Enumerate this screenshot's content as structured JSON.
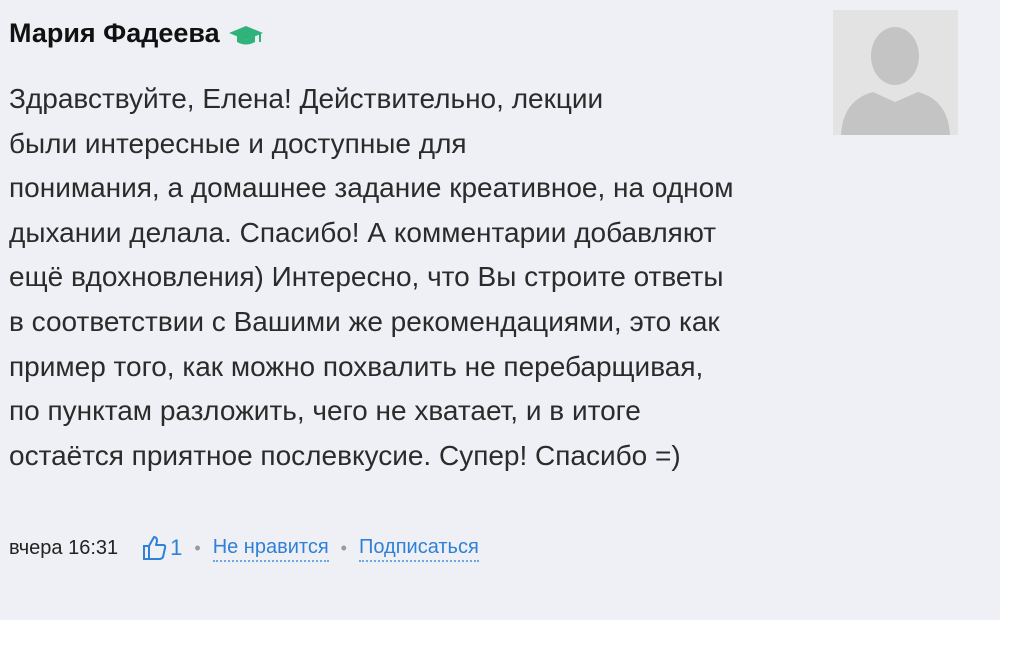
{
  "comment": {
    "author": "Мария Фадеева",
    "author_badge_icon": "graduation-cap-icon",
    "badge_color": "#2fb37a",
    "avatar_icon": "user-silhouette-icon",
    "text": "Здравствуйте, Елена! Действительно, лекции\nбыли интересные и доступные для\nпонимания, а домашнее задание креативное, на одном\nдыхании делала. Спасибо! А комментарии добавляют\nещё вдохновления) Интересно, что Вы строите ответы\nв соответствии с Вашими же рекомендациями, это как\nпример того, как можно похвалить не перебарщивая,\nпо пунктам разложить, чего не хватает, и в итоге\nостаётся приятное послевкусие. Супер! Спасибо =)",
    "meta": {
      "time": "вчера 16:31",
      "like_icon": "thumbs-up-icon",
      "like_count": "1",
      "separator": "•",
      "dislike_label": "Не нравится",
      "subscribe_label": "Подписаться"
    }
  },
  "colors": {
    "background": "#eff0f5",
    "link": "#2f80d6"
  }
}
